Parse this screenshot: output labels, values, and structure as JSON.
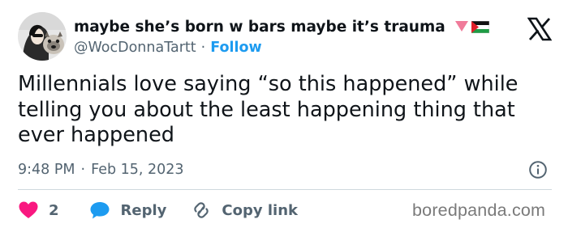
{
  "author": {
    "display_name": "maybe she’s born w bars maybe it’s trauma",
    "handle": "@WocDonnaTartt",
    "separator": "·",
    "follow_label": "Follow"
  },
  "tweet": {
    "text": "Millennials love saying “so this happened” while telling you about the least happening thing that ever happened",
    "time": "9:48 PM",
    "separator": "·",
    "date": "Feb 15, 2023"
  },
  "actions": {
    "like_count": "2",
    "reply_label": "Reply",
    "copy_link_label": "Copy link"
  },
  "watermark": "boredpanda.com",
  "colors": {
    "accent": "#1d9bf0",
    "like": "#f91880",
    "muted_text": "#536471",
    "divider": "#cfd9de"
  },
  "icons": {
    "avatar": "avatar-photo",
    "name_emoji": [
      "pink-heart-emoji",
      "palestine-flag-emoji"
    ],
    "brand": "x-logo-icon",
    "info": "info-circle-icon",
    "like": "heart-icon",
    "reply": "speech-bubble-icon",
    "copy": "link-icon"
  }
}
